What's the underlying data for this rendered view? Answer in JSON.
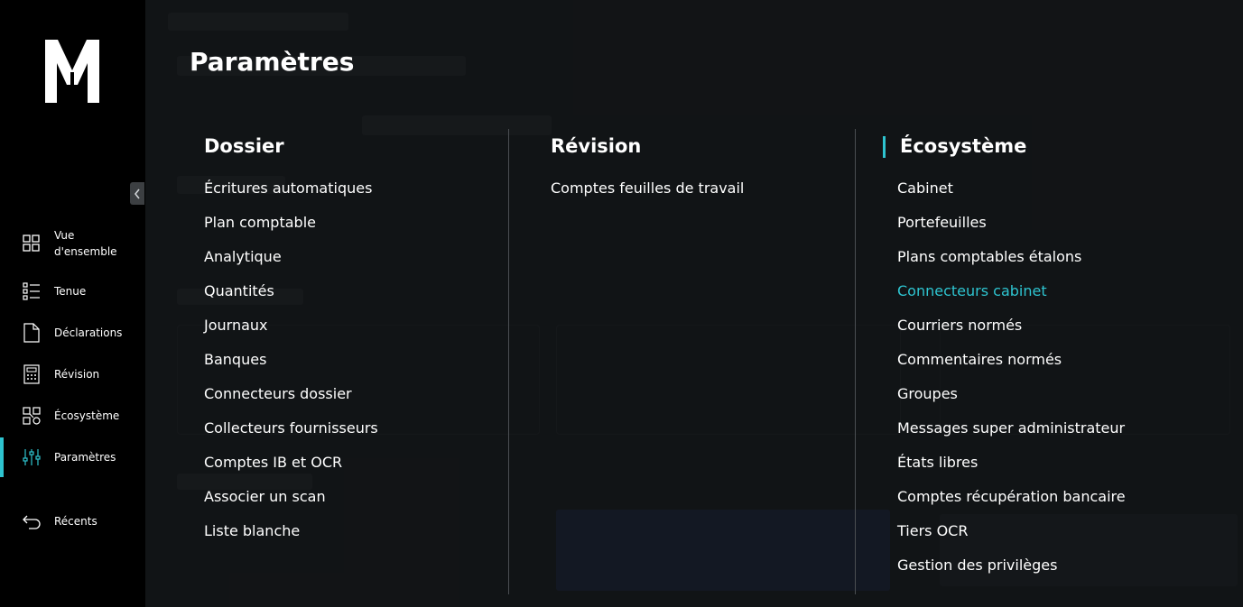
{
  "sidebar": {
    "logo_alt": "M",
    "items": [
      {
        "label": "Vue d'ensemble",
        "icon": "grid-icon"
      },
      {
        "label": "Tenue",
        "icon": "list-icon"
      },
      {
        "label": "Déclarations",
        "icon": "document-icon"
      },
      {
        "label": "Révision",
        "icon": "calculator-icon"
      },
      {
        "label": "Écosystème",
        "icon": "ecosystem-icon"
      },
      {
        "label": "Paramètres",
        "icon": "sliders-icon",
        "active": true
      },
      {
        "label": "Récents",
        "icon": "back-arrow-icon"
      }
    ]
  },
  "panel": {
    "title": "Paramètres",
    "columns": [
      {
        "heading": "Dossier",
        "links": [
          "Écritures automatiques",
          "Plan comptable",
          "Analytique",
          "Quantités",
          "Journaux",
          "Banques",
          "Connecteurs dossier",
          "Collecteurs fournisseurs",
          "Comptes IB et OCR",
          "Associer un scan",
          "Liste blanche"
        ]
      },
      {
        "heading": "Révision",
        "links": [
          "Comptes feuilles de travail"
        ]
      },
      {
        "heading": "Écosystème",
        "links": [
          "Cabinet",
          "Portefeuilles",
          "Plans comptables étalons",
          "Connecteurs cabinet",
          "Courriers normés",
          "Commentaires normés",
          "Groupes",
          "Messages super administrateur",
          "États libres",
          "Comptes récupération bancaire",
          "Tiers OCR",
          "Gestion des privilèges"
        ],
        "active_link": "Connecteurs cabinet"
      }
    ]
  },
  "colors": {
    "accent": "#2ec4d0",
    "sidebar_bg": "#000000",
    "overlay_bg": "#121416"
  }
}
